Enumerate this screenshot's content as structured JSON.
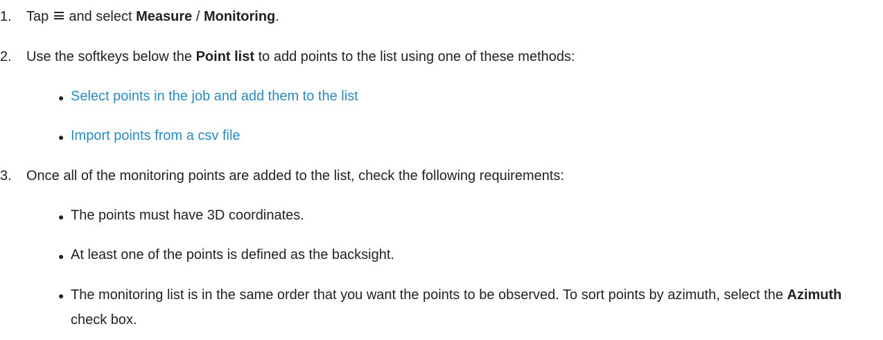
{
  "steps": [
    {
      "number": "1.",
      "text_before": "Tap",
      "icon": "hamburger-menu-icon",
      "text_middle": "and select",
      "bold_1": "Measure",
      "separator": "/",
      "bold_2": "Monitoring",
      "text_after": "."
    },
    {
      "number": "2.",
      "text_before": "Use the softkeys below the",
      "bold": "Point list",
      "text_after": "to add points to the list using one of these methods:",
      "bullets": [
        {
          "link_text": "Select points in the job and add them to the list"
        },
        {
          "link_text": "Import points from a csv file"
        }
      ]
    },
    {
      "number": "3.",
      "text": "Once all of the monitoring points are added to the list, check the following requirements:",
      "bullets": [
        {
          "text": "The points must have 3D coordinates."
        },
        {
          "text": "At least one of the points is defined as the backsight."
        },
        {
          "text_before": "The monitoring list is in the same order that you want the points to be observed. To sort points by azimuth, select the",
          "bold": "Azimuth",
          "text_after": "check box."
        }
      ]
    }
  ]
}
